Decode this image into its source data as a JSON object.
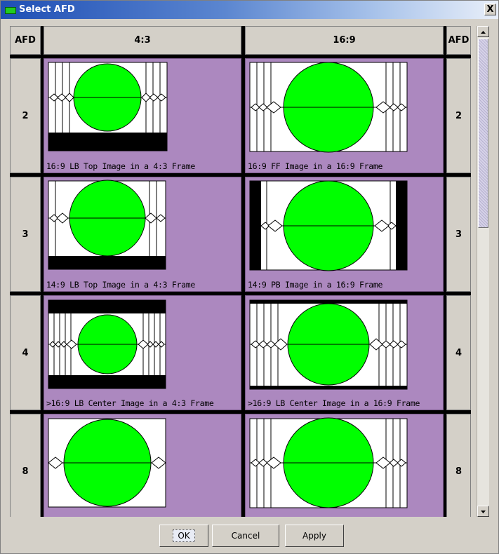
{
  "window": {
    "title": "Select AFD",
    "close_label": "X"
  },
  "table": {
    "headers": {
      "afd_left": "AFD",
      "col_43": "4:3",
      "col_169": "16:9",
      "afd_right": "AFD"
    },
    "rows": [
      {
        "afd": "2",
        "left_caption": "16:9 LB Top Image in a 4:3 Frame",
        "right_caption": "16:9 FF Image in a 16:9 Frame"
      },
      {
        "afd": "3",
        "left_caption": "14:9 LB Top Image in a 4:3 Frame",
        "right_caption": "14:9 PB Image in a 16:9 Frame"
      },
      {
        "afd": "4",
        "left_caption": ">16:9 LB Center Image in a 4:3 Frame",
        "right_caption": ">16:9 LB Center Image in a 16:9 Frame"
      },
      {
        "afd": "8",
        "left_caption": "",
        "right_caption": ""
      }
    ]
  },
  "buttons": {
    "ok": "OK",
    "cancel": "Cancel",
    "apply": "Apply"
  },
  "colors": {
    "cell_bg": "#ac88bf",
    "circle": "#00ff00",
    "frame_bar": "#000000"
  },
  "icons": {
    "title": "window-app-icon",
    "close": "close-icon",
    "scroll_up": "scroll-up-arrow-icon",
    "scroll_down": "scroll-down-arrow-icon"
  }
}
